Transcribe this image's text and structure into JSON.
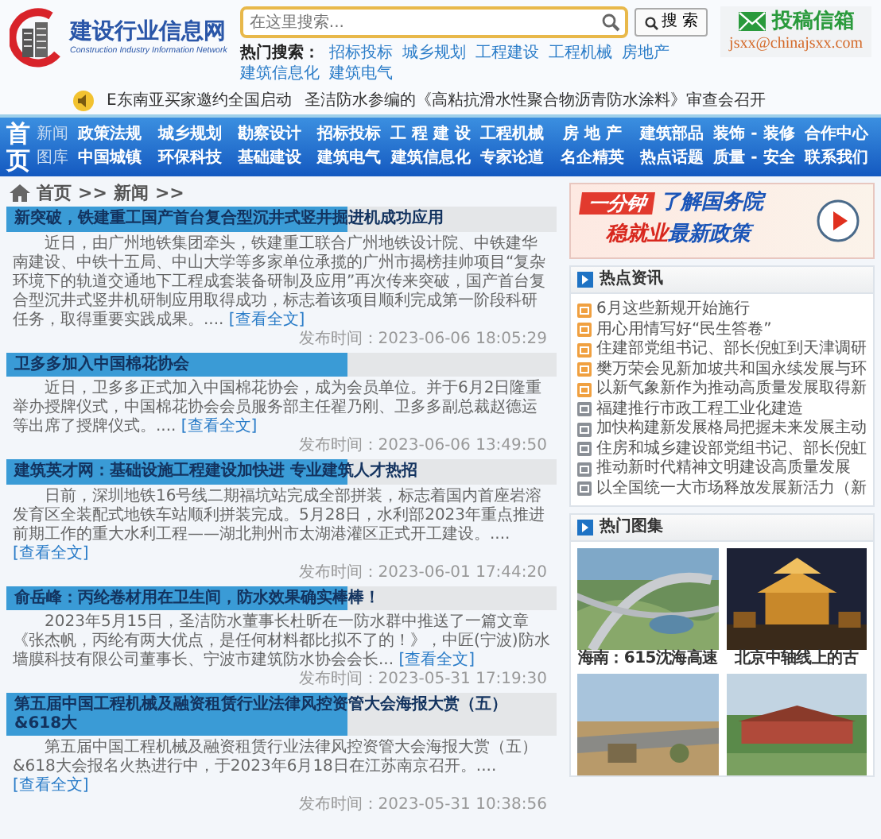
{
  "header": {
    "logo": {
      "title": "建设行业信息网",
      "subtitle": "Construction Industry Information Network"
    },
    "search": {
      "placeholder": "在这里搜索...",
      "button": "搜 索"
    },
    "hot_search": {
      "label": "热门搜索：",
      "links": [
        "招标投标",
        "城乡规划",
        "工程建设",
        "工程机械",
        "房地产",
        "建筑信息化",
        "建筑电气"
      ]
    },
    "mailbox": {
      "title": "投稿信箱",
      "email": "jsxx@chinajsxx.com"
    },
    "ticker": [
      "E东南亚买家邀约全国启动",
      "圣洁防水参编的《高粘抗滑水性聚合物沥青防水涂料》审查会召开"
    ]
  },
  "nav": {
    "home": "首页",
    "rows": [
      [
        {
          "label": "新闻",
          "kind": "sub"
        },
        {
          "label": "政策法规",
          "kind": "main"
        },
        {
          "label": "城乡规划",
          "kind": "main"
        },
        {
          "label": "勘察设计",
          "kind": "main"
        },
        {
          "label": "招标投标",
          "kind": "main"
        },
        {
          "label": "工 程 建 设",
          "kind": "main"
        },
        {
          "label": "工程机械",
          "kind": "main"
        },
        {
          "label": "房 地 产",
          "kind": "main"
        },
        {
          "label": "建筑部品",
          "kind": "main"
        },
        {
          "label": "装饰 - 装修",
          "kind": "main"
        },
        {
          "label": "合作中心",
          "kind": "main"
        }
      ],
      [
        {
          "label": "图库",
          "kind": "sub"
        },
        {
          "label": "中国城镇",
          "kind": "main"
        },
        {
          "label": "环保科技",
          "kind": "main"
        },
        {
          "label": "基础建设",
          "kind": "main"
        },
        {
          "label": "建筑电气",
          "kind": "main"
        },
        {
          "label": "建筑信息化",
          "kind": "main"
        },
        {
          "label": "专家论道",
          "kind": "main"
        },
        {
          "label": "名企精英",
          "kind": "main"
        },
        {
          "label": "热点话题",
          "kind": "main"
        },
        {
          "label": "质量 - 安全",
          "kind": "main"
        },
        {
          "label": "联系我们",
          "kind": "main"
        }
      ]
    ]
  },
  "breadcrumb": [
    {
      "label": "首页",
      "separator": ">>"
    },
    {
      "label": "新闻",
      "separator": ">>"
    }
  ],
  "articles": [
    {
      "title": "新突破，铁建重工国产首台复合型沉井式竖井掘进机成功应用",
      "body": "近日，由广州地铁集团牵头，铁建重工联合广州地铁设计院、中铁建华南建设、中铁十五局、中山大学等多家单位承揽的广州市揭榜挂帅项目“复杂环境下的轨道交通地下工程成套装备研制及应用”再次传来突破，国产首台复合型沉井式竖井机研制应用取得成功，标志着该项目顺利完成第一阶段科研任务，取得重要实践成果。....",
      "more": "[查看全文]",
      "date": "发布时间：2023-06-06 18:05:29"
    },
    {
      "title": "卫多多加入中国棉花协会",
      "body": "近日，卫多多正式加入中国棉花协会，成为会员单位。并于6月2日隆重举办授牌仪式，中国棉花协会会员服务部主任翟乃刚、卫多多副总裁赵德运等出席了授牌仪式。....",
      "more": "[查看全文]",
      "date": "发布时间：2023-06-06 13:49:50"
    },
    {
      "title": "建筑英才网：基础设施工程建设加快进 专业建筑人才热招",
      "body": "日前，深圳地铁16号线二期福坑站完成全部拼装，标志着国内首座岩溶发育区全装配式地铁车站顺利拼装完成。5月28日，水利部2023年重点推进前期工作的重大水利工程——湖北荆州市太湖港灌区正式开工建设。....",
      "more": "[查看全文]",
      "date": "发布时间：2023-06-01 17:44:20"
    },
    {
      "title": "俞岳峰：丙纶卷材用在卫生间，防水效果确实棒棒！",
      "body": "2023年5月15日，圣洁防水董事长杜昕在一防水群中推送了一篇文章《张杰帆，丙纶有两大优点，是任何材料都比拟不了的！》，中匠(宁波)防水墙膜科技有限公司董事长、宁波市建筑防水协会会长...",
      "more": "[查看全文]",
      "date": "发布时间：2023-05-31 17:19:30"
    },
    {
      "title": "第五届中国工程机械及融资租赁行业法律风控资管大会海报大赏（五）&618大",
      "body": "第五届中国工程机械及融资租赁行业法律风控资管大会海报大赏（五）&618大会报名火热进行中，于2023年6月18日在江苏南京召开。....",
      "more": "[查看全文]",
      "date": "发布时间：2023-05-31 10:38:56"
    }
  ],
  "banner": {
    "tag": "一分钟",
    "line1": "了解国务院",
    "line2_highlight": "稳就业",
    "line2": "最新政策"
  },
  "hot_news": {
    "title": "热点资讯",
    "items": [
      {
        "label": "6月这些新规开始施行",
        "hot": true
      },
      {
        "label": "用心用情写好“民生答卷”",
        "hot": true
      },
      {
        "label": "住建部党组书记、部长倪虹到天津调研",
        "hot": true
      },
      {
        "label": "樊万荣会见新加坡共和国永续发展与环",
        "hot": true
      },
      {
        "label": "以新气象新作为推动高质量发展取得新",
        "hot": true
      },
      {
        "label": "福建推行市政工程工业化建造",
        "hot": false
      },
      {
        "label": "加快构建新发展格局把握未来发展主动",
        "hot": false
      },
      {
        "label": "住房和城乡建设部党组书记、部长倪虹",
        "hot": false
      },
      {
        "label": "推动新时代精神文明建设高质量发展",
        "hot": false
      },
      {
        "label": "以全国统一大市场释放发展新活力（新",
        "hot": false
      }
    ]
  },
  "gallery": {
    "title": "热门图集",
    "items": [
      {
        "kind": "picture",
        "caption": "海南：615沈海高速"
      },
      {
        "kind": "picture",
        "caption": "北京中轴线上的古"
      },
      {
        "kind": "picture"
      },
      {
        "kind": "picture"
      }
    ]
  }
}
